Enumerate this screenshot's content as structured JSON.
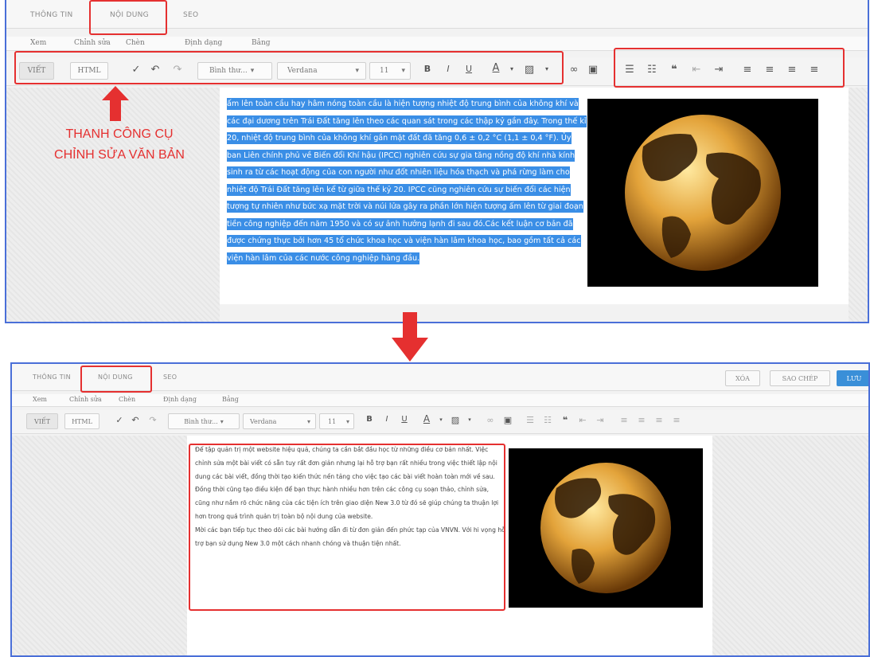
{
  "colors": {
    "highlight": "#3a8ee6",
    "annotation": "#e53030",
    "frame": "#4a6fd8",
    "save": "#3a8fd8"
  },
  "tabs": [
    "THÔNG TIN",
    "NỘI DUNG",
    "SEO"
  ],
  "menus": [
    "Xem",
    "Chỉnh sửa",
    "Chèn",
    "Định dạng",
    "Bảng"
  ],
  "toolbar": {
    "viet": "VIẾT",
    "html": "HTML",
    "format": "Bình thư...",
    "font": "Verdana",
    "size": "11",
    "bold": "B",
    "italic": "I",
    "underline": "U",
    "font_color": "A",
    "arrow": "▾"
  },
  "annotation": {
    "line1": "THANH CÔNG CỤ",
    "line2": "CHỈNH SỬA VĂN BẢN"
  },
  "panel1": {
    "paragraph": "ấm lên toàn cầu hay hâm nóng toàn cầu là hiện tượng nhiệt độ trung bình của không khí và các đại dương trên Trái Đất tăng lên theo các quan sát trong các thập kỷ gần đây. Trong thế kỉ 20, nhiệt độ trung bình của không khí gần mặt đất đã tăng 0,6 ± 0,2 °C (1,1 ± 0,4 °F). Ủy ban Liên chính phủ về Biến đổi Khí hậu (IPCC) nghiên cứu sự gia tăng nồng độ khí nhà kính sinh ra từ các hoạt động của con người như đốt nhiên liệu hóa thạch và phá rừng làm cho nhiệt độ Trái Đất tăng lên kể từ giữa thế kỷ 20. IPCC cũng nghiên cứu sự biến đổi các hiện tượng tự nhiên như bức xạ mặt trời và núi lửa gây ra phần lớn hiện tượng ấm lên từ giai đoạn tiền công nghiệp đến năm 1950 và có sự ảnh hưởng lạnh đi sau đó.Các kết luận cơ bản đã được chứng thực bởi hơn 45 tổ chức khoa học và viện hàn lâm khoa học, bao gồm tất cả các viện hàn lâm của các nước công nghiệp hàng đầu."
  },
  "panel2": {
    "buttons": {
      "delete": "XÓA",
      "copy": "SAO CHÉP",
      "save": "LƯU"
    },
    "p1": "Để tập quản trị một website hiệu quả, chúng ta cần bắt đầu học từ những điều cơ bản nhất. Việc chỉnh sửa một bài viết có sẵn tuy rất đơn giản nhưng lại hỗ trợ bạn rất nhiều trong việc thiết lập nội dung các bài viết, đồng thời tạo kiến thức nền tảng cho việc tạo các bài viết hoàn toàn mới về sau.",
    "p2": "Đồng thời cũng tạo điều kiện để bạn thực hành nhiều hơn trên các công cụ soạn thảo, chỉnh sửa, cũng như nắm rõ chức năng của các tiện ích trên giao diện New 3.0 từ đó sẽ giúp chúng ta thuận lợi hơn trong quá trình quản trị toàn bộ nội dung của website.",
    "p3": "Mời các bạn tiếp tục theo dõi các bài hướng dẫn đi từ đơn giản đến phức tạp của VNVN. Với hi vọng hỗ trợ bạn sử dụng New 3.0 một cách nhanh chóng và thuận tiện nhất."
  }
}
